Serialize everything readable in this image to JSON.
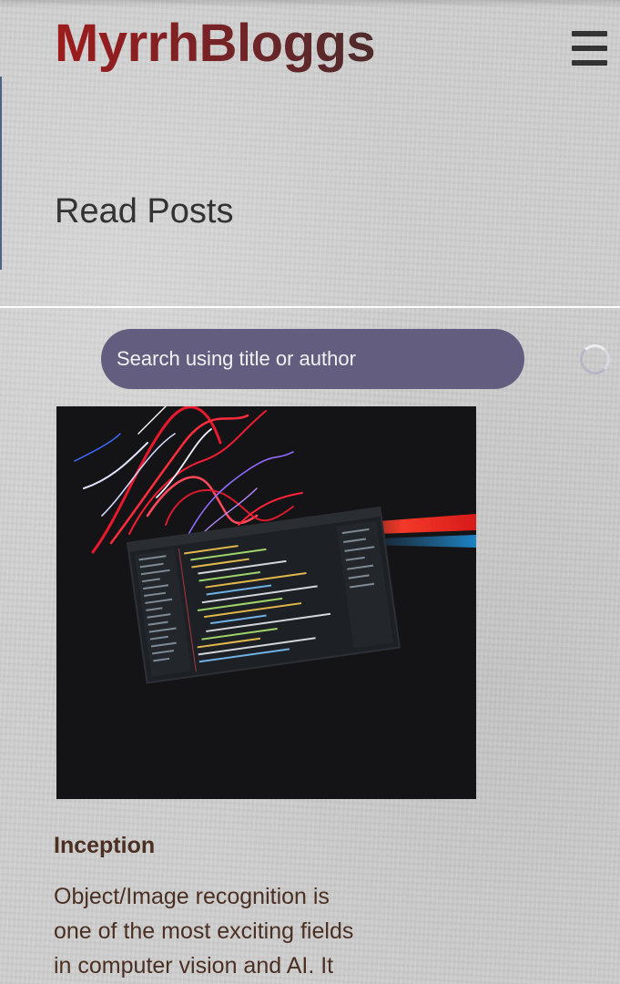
{
  "header": {
    "brand": "MyrrhBloggs",
    "menu_icon": "hamburger-menu-icon"
  },
  "page": {
    "title": "Read Posts"
  },
  "search": {
    "placeholder": "Search using title or author",
    "loading_icon": "loading-spinner-icon"
  },
  "posts": [
    {
      "title": "Inception",
      "image_description": "laptop with code editor and light trails",
      "excerpt_lines": [
        "Object/Image recognition is",
        "one of the most exciting fields",
        "in computer vision and AI. It"
      ]
    }
  ],
  "colors": {
    "brand_red": "#9e1c1c",
    "search_bg": "#635e7f",
    "text_dark": "#333333",
    "post_text": "#4a2f22"
  }
}
